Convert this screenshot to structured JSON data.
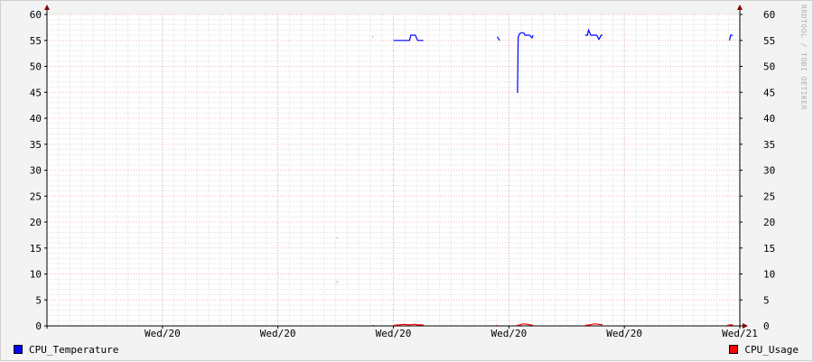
{
  "chart_data": {
    "type": "line",
    "title": "",
    "xlabel": "",
    "ylabel": "",
    "ylim": [
      0,
      60
    ],
    "yticks": [
      "0",
      "5",
      "10",
      "15",
      "20",
      "25",
      "30",
      "35",
      "40",
      "45",
      "50",
      "55",
      "60"
    ],
    "xlim": [
      0,
      600
    ],
    "xticks": [
      {
        "x": 100,
        "label": "Wed/20"
      },
      {
        "x": 200,
        "label": "Wed/20"
      },
      {
        "x": 300,
        "label": "Wed/20"
      },
      {
        "x": 400,
        "label": "Wed/20"
      },
      {
        "x": 500,
        "label": "Wed/20"
      },
      {
        "x": 600,
        "label": "Wed/21"
      }
    ],
    "grid": true,
    "series": [
      {
        "name": "CPU_Temperature",
        "color": "#0000ff",
        "segments": [
          [
            [
              251,
              8.5
            ],
            [
              251.5,
              8.5
            ]
          ],
          [
            [
              282,
              55.7
            ],
            [
              282.5,
              55.7
            ]
          ],
          [
            [
              300,
              55
            ],
            [
              314,
              55
            ],
            [
              315,
              56
            ],
            [
              319,
              56
            ],
            [
              321,
              55
            ],
            [
              326,
              55
            ]
          ],
          [
            [
              390,
              55.7
            ],
            [
              392,
              55
            ]
          ],
          [
            [
              407,
              45
            ],
            [
              407.5,
              45
            ],
            [
              408,
              55.5
            ],
            [
              409,
              56.2
            ],
            [
              411,
              56.5
            ],
            [
              413,
              56.4
            ],
            [
              414,
              56
            ],
            [
              418,
              56
            ],
            [
              420,
              55.5
            ],
            [
              421,
              56
            ]
          ],
          [
            [
              466,
              56
            ],
            [
              468,
              56
            ],
            [
              469,
              57
            ],
            [
              471,
              56
            ],
            [
              476,
              56
            ],
            [
              478,
              55.2
            ],
            [
              480,
              56
            ],
            [
              481,
              56
            ]
          ],
          [
            [
              591,
              55
            ],
            [
              592,
              56
            ],
            [
              593,
              56
            ],
            [
              594,
              56
            ]
          ]
        ]
      },
      {
        "name": "CPU_Usage",
        "color": "#ff0000",
        "segments": [
          [
            [
              251,
              17
            ],
            [
              251.5,
              17
            ]
          ],
          [
            [
              282,
              0.1
            ],
            [
              283,
              0.1
            ]
          ],
          [
            [
              300,
              0.1
            ],
            [
              305,
              0.2
            ],
            [
              309,
              0.3
            ],
            [
              313,
              0.2
            ],
            [
              318,
              0.3
            ],
            [
              322,
              0.2
            ],
            [
              326,
              0.2
            ]
          ],
          [
            [
              389,
              0.1
            ],
            [
              390,
              0.1
            ]
          ],
          [
            [
              407,
              0.1
            ],
            [
              410,
              0.2
            ],
            [
              412,
              0.4
            ],
            [
              416,
              0.3
            ],
            [
              421,
              0.1
            ]
          ],
          [
            [
              466,
              0.1
            ],
            [
              470,
              0.2
            ],
            [
              474,
              0.4
            ],
            [
              478,
              0.3
            ],
            [
              481,
              0.2
            ]
          ],
          [
            [
              589,
              0.1
            ],
            [
              592,
              0.2
            ],
            [
              594,
              0.2
            ]
          ]
        ]
      }
    ],
    "legend": "bottom",
    "watermark": "RRDTOOL / TOBI OETIKER"
  }
}
